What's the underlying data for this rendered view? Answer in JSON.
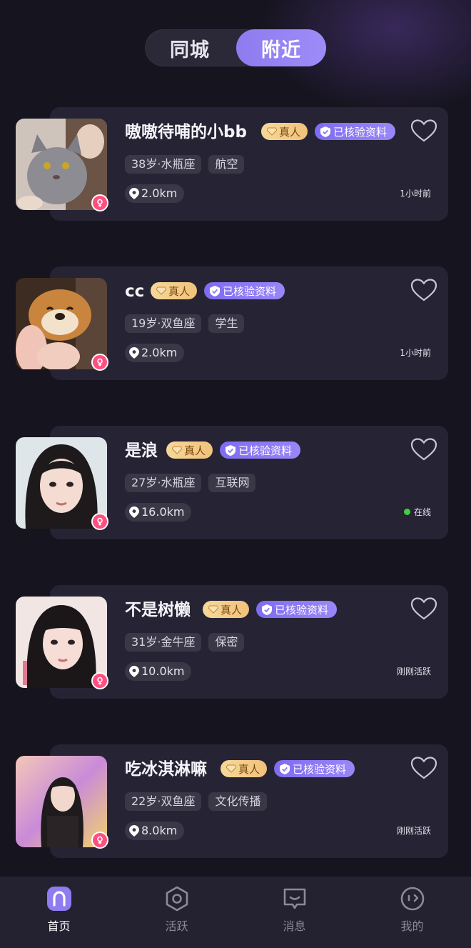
{
  "tabs": {
    "left": "同城",
    "right": "附近",
    "active": "right"
  },
  "badges": {
    "real": "真人",
    "verified": "已核验资料"
  },
  "users": [
    {
      "name": "嗷嗷待哺的小bb",
      "age": "38岁·水瓶座",
      "job": "航空",
      "distance": "2.0km",
      "status": "1小时前",
      "online": false
    },
    {
      "name": "cc",
      "age": "19岁·双鱼座",
      "job": "学生",
      "distance": "2.0km",
      "status": "1小时前",
      "online": false
    },
    {
      "name": "是浪",
      "age": "27岁·水瓶座",
      "job": "互联网",
      "distance": "16.0km",
      "status": "在线",
      "online": true
    },
    {
      "name": "不是树懒",
      "age": "31岁·金牛座",
      "job": "保密",
      "distance": "10.0km",
      "status": "刚刚活跃",
      "online": false
    },
    {
      "name": "吃冰淇淋嘛",
      "age": "22岁·双鱼座",
      "job": "文化传播",
      "distance": "8.0km",
      "status": "刚刚活跃",
      "online": false
    }
  ],
  "nav": [
    {
      "label": "首页",
      "icon": "home-icon",
      "active": true
    },
    {
      "label": "活跃",
      "icon": "target-icon",
      "active": false
    },
    {
      "label": "消息",
      "icon": "message-icon",
      "active": false
    },
    {
      "label": "我的",
      "icon": "profile-face-icon",
      "active": false
    }
  ],
  "colors": {
    "accent": "#8e7cf0",
    "background": "#16141f",
    "card": "#262434",
    "online": "#3ed23e"
  }
}
